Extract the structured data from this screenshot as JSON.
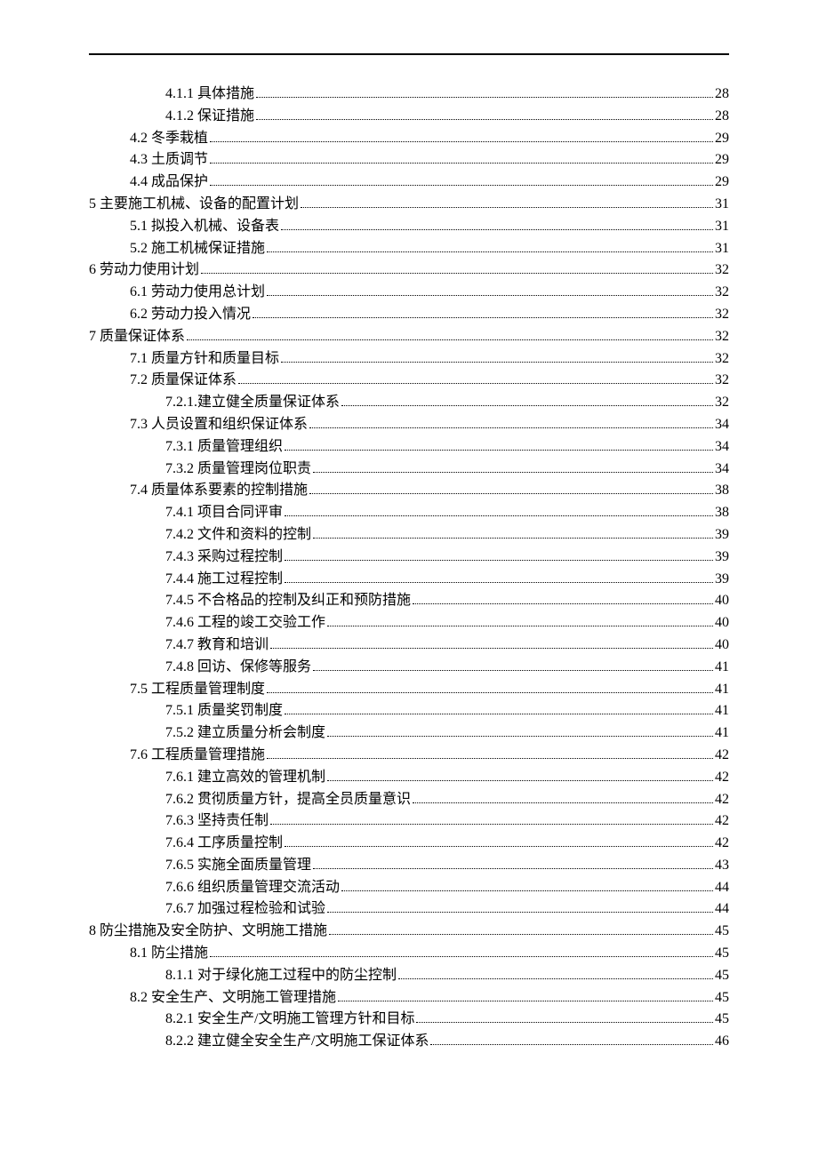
{
  "toc": [
    {
      "level": 2,
      "title": "4.1.1 具体措施",
      "page": "28"
    },
    {
      "level": 2,
      "title": "4.1.2 保证措施",
      "page": "28"
    },
    {
      "level": 1,
      "title": "4.2 冬季栽植",
      "page": "29"
    },
    {
      "level": 1,
      "title": "4.3 土质调节",
      "page": "29"
    },
    {
      "level": 1,
      "title": "4.4 成品保护",
      "page": "29"
    },
    {
      "level": 0,
      "title": "5 主要施工机械、设备的配置计划",
      "page": "31"
    },
    {
      "level": 1,
      "title": "5.1 拟投入机械、设备表",
      "page": "31"
    },
    {
      "level": 1,
      "title": "5.2 施工机械保证措施",
      "page": "31"
    },
    {
      "level": 0,
      "title": "6 劳动力使用计划",
      "page": "32"
    },
    {
      "level": 1,
      "title": "6.1 劳动力使用总计划",
      "page": "32"
    },
    {
      "level": 1,
      "title": "6.2 劳动力投入情况",
      "page": "32"
    },
    {
      "level": 0,
      "title": "7 质量保证体系",
      "page": "32"
    },
    {
      "level": 1,
      "title": "7.1 质量方针和质量目标",
      "page": "32"
    },
    {
      "level": 1,
      "title": "7.2 质量保证体系",
      "page": "32"
    },
    {
      "level": 2,
      "title": "7.2.1.建立健全质量保证体系",
      "page": "32"
    },
    {
      "level": 1,
      "title": "7.3 人员设置和组织保证体系",
      "page": "34"
    },
    {
      "level": 2,
      "title": "7.3.1 质量管理组织",
      "page": "34"
    },
    {
      "level": 2,
      "title": "7.3.2 质量管理岗位职责",
      "page": "34"
    },
    {
      "level": 1,
      "title": "7.4 质量体系要素的控制措施",
      "page": "38"
    },
    {
      "level": 2,
      "title": "7.4.1  项目合同评审",
      "page": "38"
    },
    {
      "level": 2,
      "title": "7.4.2  文件和资料的控制",
      "page": "39"
    },
    {
      "level": 2,
      "title": "7.4.3  采购过程控制",
      "page": "39"
    },
    {
      "level": 2,
      "title": "7.4.4  施工过程控制",
      "page": "39"
    },
    {
      "level": 2,
      "title": "7.4.5  不合格品的控制及纠正和预防措施",
      "page": "40"
    },
    {
      "level": 2,
      "title": "7.4.6  工程的竣工交验工作",
      "page": "40"
    },
    {
      "level": 2,
      "title": "7.4.7  教育和培训",
      "page": "40"
    },
    {
      "level": 2,
      "title": "7.4.8  回访、保修等服务",
      "page": "41"
    },
    {
      "level": 1,
      "title": "7.5 工程质量管理制度",
      "page": "41"
    },
    {
      "level": 2,
      "title": "7.5.1  质量奖罚制度",
      "page": "41"
    },
    {
      "level": 2,
      "title": "7.5.2  建立质量分析会制度",
      "page": "41"
    },
    {
      "level": 1,
      "title": "7.6 工程质量管理措施",
      "page": "42"
    },
    {
      "level": 2,
      "title": "7.6.1  建立高效的管理机制",
      "page": "42"
    },
    {
      "level": 2,
      "title": "7.6.2  贯彻质量方针，提高全员质量意识",
      "page": "42"
    },
    {
      "level": 2,
      "title": "7.6.3  坚持责任制",
      "page": "42"
    },
    {
      "level": 2,
      "title": "7.6.4  工序质量控制",
      "page": "42"
    },
    {
      "level": 2,
      "title": "7.6.5  实施全面质量管理",
      "page": "43"
    },
    {
      "level": 2,
      "title": "7.6.6  组织质量管理交流活动",
      "page": "44"
    },
    {
      "level": 2,
      "title": "7.6.7  加强过程检验和试验",
      "page": "44"
    },
    {
      "level": 0,
      "title": "8 防尘措施及安全防护、文明施工措施",
      "page": "45"
    },
    {
      "level": 1,
      "title": "8.1 防尘措施",
      "page": "45"
    },
    {
      "level": 2,
      "title": "8.1.1 对于绿化施工过程中的防尘控制",
      "page": "45"
    },
    {
      "level": 1,
      "title": "8.2  安全生产、文明施工管理措施",
      "page": "45"
    },
    {
      "level": 2,
      "title": "8.2.1 安全生产/文明施工管理方针和目标",
      "page": "45"
    },
    {
      "level": 2,
      "title": "8.2.2 建立健全安全生产/文明施工保证体系",
      "page": "46"
    }
  ]
}
